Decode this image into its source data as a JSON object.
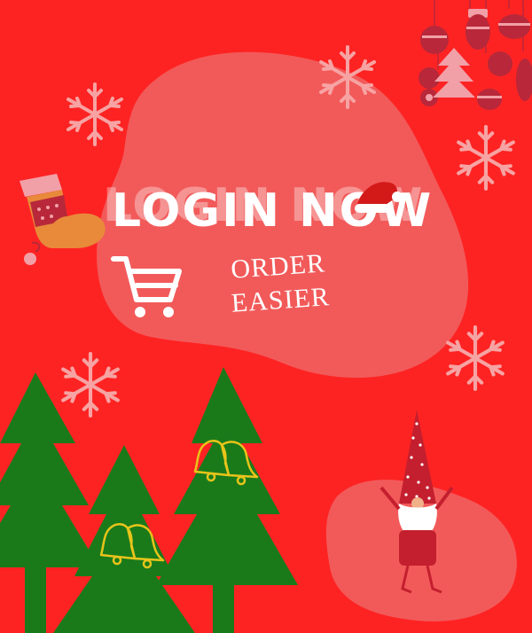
{
  "poster": {
    "title": "LOGIN NOW",
    "subtitle_line1": "ORDER",
    "subtitle_line2": "EASIER"
  },
  "colors": {
    "background": "#fe2323",
    "blob": "#f25a5a",
    "tree": "#1a7a1a",
    "bell": "#e8c41a",
    "snowflake": "#f7a3a3",
    "ornament": "#b8283a"
  },
  "icons": [
    "cart-icon",
    "santa-hat-icon",
    "stocking-icon",
    "snowflake-icon",
    "bell-icon",
    "gnome-icon",
    "ornament-icon",
    "christmas-tree-icon"
  ]
}
